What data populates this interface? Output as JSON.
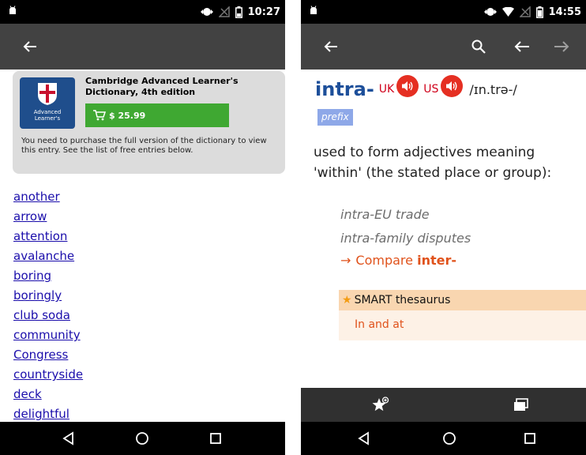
{
  "left_screen": {
    "status": {
      "time": "10:27"
    },
    "app_bar": {
      "back_icon": "arrow-left-icon"
    },
    "purchase": {
      "cover_text_line1": "Advanced",
      "cover_text_line2": "Learner's",
      "title": "Cambridge Advanced Learner's Dictionary, 4th edition",
      "price": "$ 25.99",
      "message": "You need to purchase the full version of the dictionary to view this entry. See the list of free entries below.",
      "button_color": "#3fa832"
    },
    "entries": [
      "another",
      "arrow",
      "attention",
      "avalanche",
      "boring",
      "boringly",
      "club soda",
      "community",
      "Congress",
      "countryside",
      "deck",
      "delightful"
    ]
  },
  "right_screen": {
    "status": {
      "time": "14:55"
    },
    "app_bar": {
      "icons": [
        "arrow-left-icon",
        "search-icon",
        "arrow-left-icon",
        "arrow-right-icon"
      ]
    },
    "entry": {
      "headword": "intra-",
      "uk_label": "UK",
      "us_label": "US",
      "pronunciation": "/ɪn.trə-/",
      "part_of_speech": "prefix",
      "definition": "used to form adjectives meaning 'within' (the stated place or group):",
      "examples": [
        "intra-EU trade",
        "intra-family disputes"
      ],
      "compare_arrow": "→",
      "compare_label": "Compare",
      "compare_target": "inter-",
      "thesaurus_title": "SMART thesaurus",
      "thesaurus_link": "In and at",
      "headword_color": "#1d4f9a",
      "accent_color": "#e0521b"
    },
    "bottom_tools": [
      "star-add-icon",
      "cards-icon"
    ]
  },
  "navigation": [
    "back-triangle-icon",
    "home-circle-icon",
    "recents-square-icon"
  ]
}
